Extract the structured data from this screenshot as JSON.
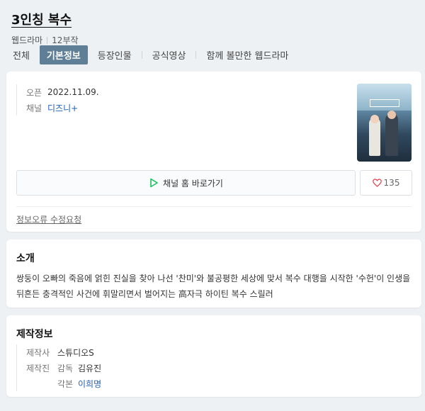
{
  "header": {
    "title": "3인칭 복수",
    "category": "웹드라마",
    "episodes": "12부작"
  },
  "tabs": [
    {
      "label": "전체",
      "active": false
    },
    {
      "label": "기본정보",
      "active": true
    },
    {
      "label": "등장인물",
      "active": false
    },
    {
      "label": "공식영상",
      "active": false
    },
    {
      "label": "함께 볼만한 웹드라마",
      "active": false
    }
  ],
  "basic_info": {
    "open_label": "오픈",
    "open_value": "2022.11.09.",
    "channel_label": "채널",
    "channel_value": "디즈니+",
    "go_button_label": "채널 홈 바로가기",
    "like_count": "135",
    "report_link": "정보오류 수정요청"
  },
  "intro": {
    "title": "소개",
    "text": "쌍둥이 오빠의 죽음에 얽힌 진실을 찾아 나선 '찬미'와 불공평한 세상에 맞서 복수 대행을 시작한 '수헌'이 인생을 뒤흔든 충격적인 사건에 휘말리면서 벌어지는 高자극 하이틴 복수 스릴러"
  },
  "production": {
    "title": "제작정보",
    "company_label": "제작사",
    "company_value": "스튜디오S",
    "staff_label": "제작진",
    "director_role": "감독",
    "director_name": "김유진",
    "writer_role": "각본",
    "writer_name": "이희명"
  },
  "colors": {
    "active_tab_bg": "#5f7f97",
    "link": "#1e5fb6",
    "page_bg": "#eef1f4",
    "play_icon": "#19c35a",
    "heart_icon": "#e23b4a"
  }
}
